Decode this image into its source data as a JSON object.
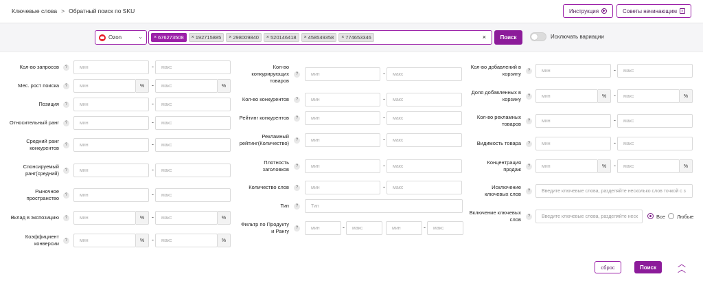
{
  "breadcrumb": {
    "root": "Ключевые слова",
    "sep": ">",
    "current": "Обратный поиск по SKU"
  },
  "header": {
    "instruction_label": "Инструкция",
    "tips_label": "Советы начинающим"
  },
  "search": {
    "platform": "Ozon",
    "tags": [
      "676273508",
      "192715885",
      "298009840",
      "520146418",
      "458549358",
      "774653346"
    ],
    "search_label": "Поиск",
    "exclude_variations_label": "Исключать вариации",
    "exclude_variations_on": false
  },
  "placeholders": {
    "min": "мин",
    "max": "макс",
    "type": "Тип",
    "pct": "%",
    "dash": "-",
    "exclude_kw": "Введите ключевые слова, разделяйте несколько слов точкой с з",
    "include_kw": "Введите ключевые слова, разделяйте неск"
  },
  "filters_col1": [
    "Кол-во запросов",
    "Мес. рост поиска",
    "Позиция",
    "Относительный ранг",
    "Средний ранг конкурентов",
    "Спонсируемый ранг(средний)",
    "Рыночное пространство",
    "Вклад в экспозицию",
    "Коэффициент конверсии"
  ],
  "filters_col2": [
    "Кол-во конкурирующих товаров",
    "Кол-во конкурентов",
    "Рейтинг конкурентов",
    "Рекламный рейтинг(Количество)",
    "Плотность заголовков",
    "Количество слов",
    "Тип",
    "Фильтр по Продукту и Рангу"
  ],
  "filters_col3": [
    "Кол-во добавлений в корзину",
    "Доля добавленных в корзину",
    "Кол-во рекламных товаров",
    "Видимость товара",
    "Концентрация продаж",
    "Исключение ключевых слов",
    "Включение ключевых слов"
  ],
  "include_mode": {
    "all": "Все",
    "any": "Любые",
    "selected": "all"
  },
  "footer": {
    "reset_label": "сброс",
    "search_label": "Поиск"
  },
  "colors": {
    "accent": "#8c1b9a"
  }
}
